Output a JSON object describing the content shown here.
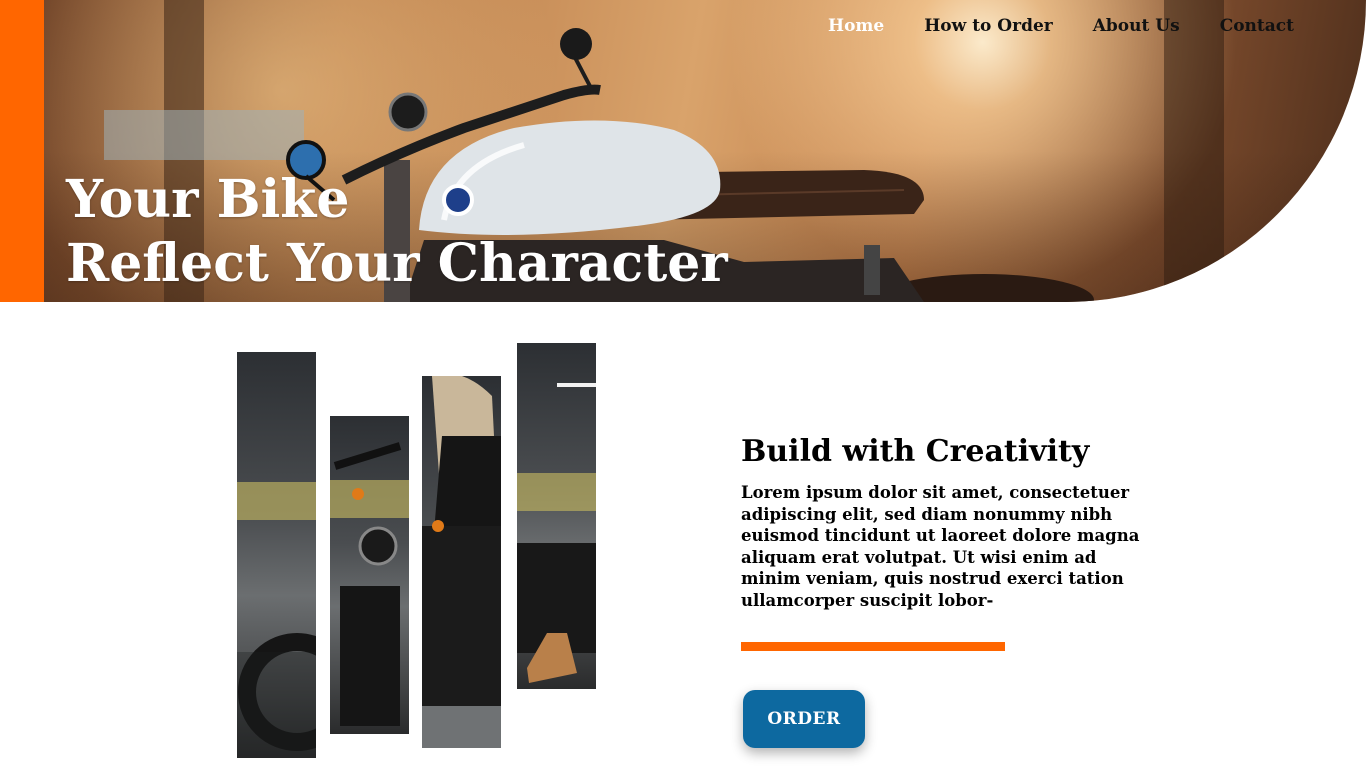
{
  "nav": {
    "items": [
      {
        "label": "Home"
      },
      {
        "label": "How to Order"
      },
      {
        "label": "About Us"
      },
      {
        "label": "Contact"
      }
    ]
  },
  "hero": {
    "title_line1": "Your Bike",
    "title_line2": "Reflect Your Character"
  },
  "feature": {
    "title": "Build with Creativity",
    "body": "Lorem ipsum dolor sit amet, consectetuer adipiscing elit, sed diam nonummy nibh euismod tincidunt ut laoreet dolore magna aliquam erat volutpat. Ut wisi enim ad minim veniam, quis nostrud exerci tation ullamcorper suscipit lobor-",
    "button_label": "ORDER"
  },
  "colors": {
    "accent": "#ff6600",
    "button": "#0d69a0"
  }
}
